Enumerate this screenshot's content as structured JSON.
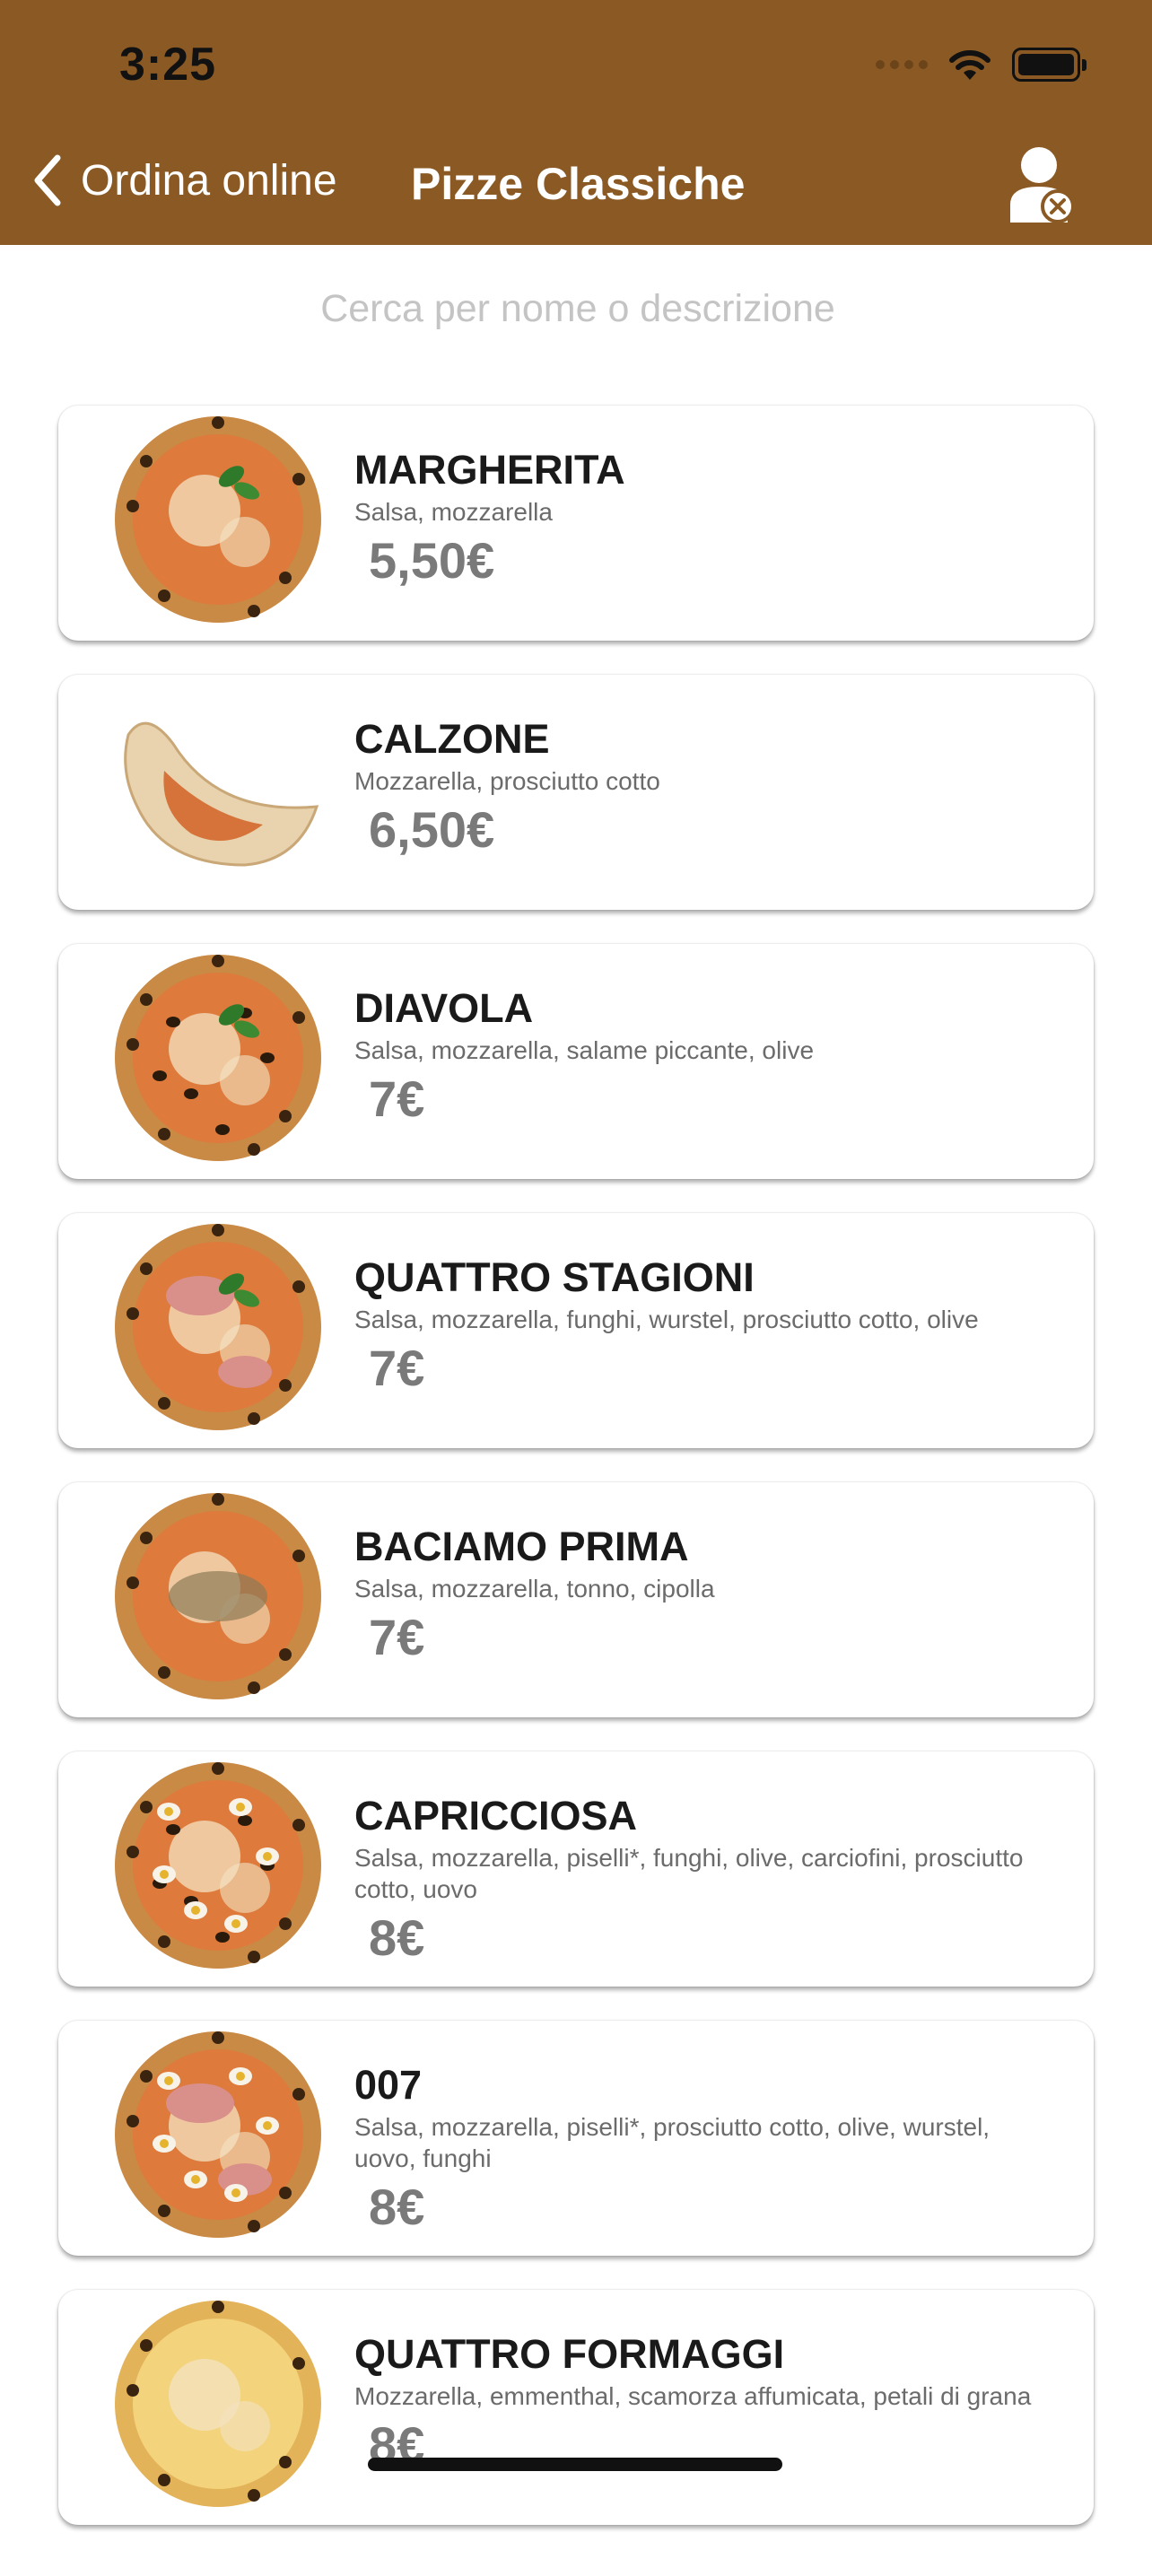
{
  "status_bar": {
    "time": "3:25"
  },
  "nav": {
    "back_label": "Ordina online",
    "title": "Pizze Classiche",
    "back_icon": "chevron-left-icon",
    "profile_icon": "user-remove-icon"
  },
  "search": {
    "placeholder": "Cerca per nome o descrizione",
    "value": ""
  },
  "colors": {
    "header": "#8b5a24",
    "price": "#7a7a7a",
    "name": "#1a1a1a"
  },
  "products": [
    {
      "name": "MARGHERITA",
      "description": "Salsa, mozzarella",
      "price": "5,50€",
      "shape": "round",
      "toppings": [
        "basil"
      ]
    },
    {
      "name": "CALZONE",
      "description": "Mozzarella, prosciutto cotto",
      "price": "6,50€",
      "shape": "calzone",
      "toppings": []
    },
    {
      "name": "DIAVOLA",
      "description": "Salsa, mozzarella, salame piccante, olive",
      "price": "7€",
      "shape": "round",
      "toppings": [
        "basil",
        "olives"
      ]
    },
    {
      "name": "QUATTRO STAGIONI",
      "description": "Salsa, mozzarella, funghi, wurstel, prosciutto cotto, olive",
      "price": "7€",
      "shape": "round",
      "toppings": [
        "basil",
        "ham"
      ]
    },
    {
      "name": "BACIAMO PRIMA",
      "description": "Salsa, mozzarella, tonno, cipolla",
      "price": "7€",
      "shape": "round",
      "toppings": [
        "tuna"
      ]
    },
    {
      "name": "CAPRICCIOSA",
      "description": "Salsa, mozzarella, piselli*, funghi, olive, carciofini, prosciutto cotto, uovo",
      "price": "8€",
      "shape": "round",
      "toppings": [
        "eggs",
        "olives"
      ]
    },
    {
      "name": "007",
      "description": "Salsa, mozzarella, piselli*, prosciutto cotto, olive, wurstel, uovo, funghi",
      "price": "8€",
      "shape": "round",
      "toppings": [
        "eggs",
        "ham"
      ]
    },
    {
      "name": "QUATTRO FORMAGGI",
      "description": "Mozzarella, emmenthal, scamorza affumicata, petali di grana",
      "price": "8€",
      "shape": "round",
      "toppings": [
        "cheese"
      ]
    }
  ]
}
